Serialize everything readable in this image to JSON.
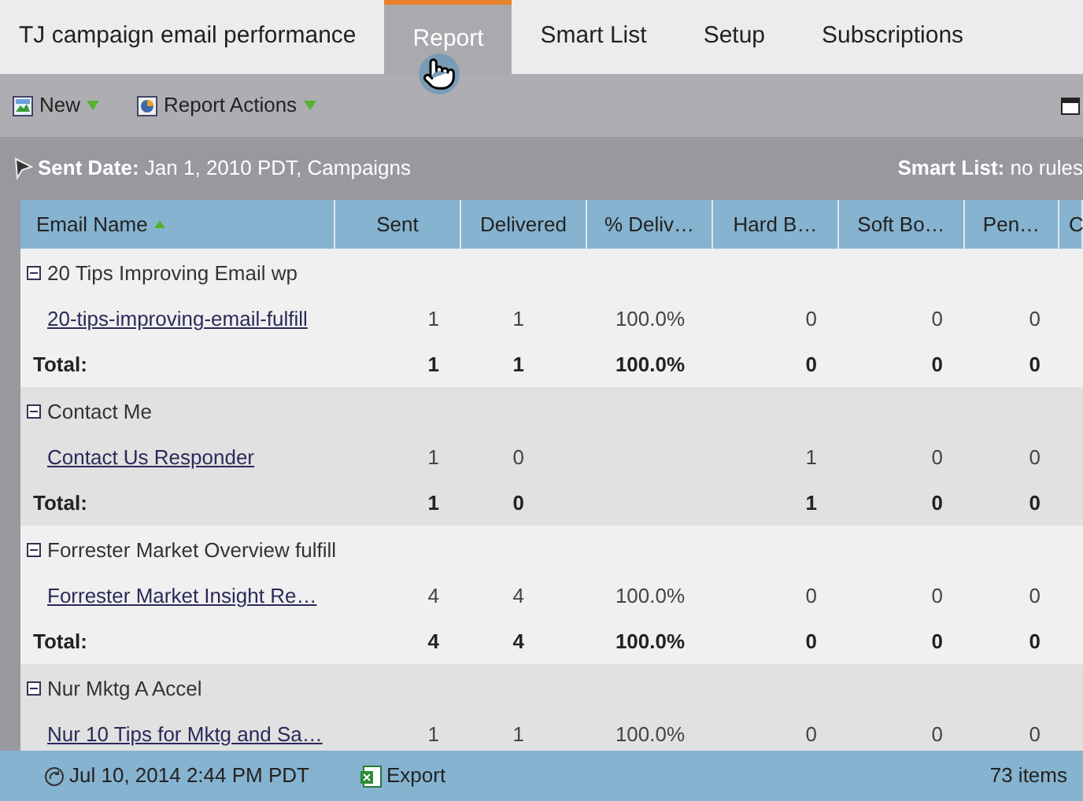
{
  "title": "TJ campaign email performance",
  "tabs": [
    {
      "label": "Report",
      "selected": true
    },
    {
      "label": "Smart List",
      "selected": false
    },
    {
      "label": "Setup",
      "selected": false
    },
    {
      "label": "Subscriptions",
      "selected": false
    }
  ],
  "toolbar": [
    {
      "label": "New",
      "kind": "new"
    },
    {
      "label": "Report Actions",
      "kind": "actions"
    }
  ],
  "filter": {
    "label": "Sent Date:",
    "value": "Jan 1, 2010 PDT, Campaigns",
    "smart_list_label": "Smart List:",
    "smart_list_value": "no rules"
  },
  "table": {
    "columns": [
      "Email Name",
      "Sent",
      "Delivered",
      "% Deliv…",
      "Hard B…",
      "Soft Bo…",
      "Pen…",
      "C"
    ],
    "groups": [
      {
        "name": "20 Tips Improving Email wp",
        "expanded": true,
        "rows": [
          {
            "name": "20-tips-improving-email-fulfill",
            "cells": [
              "1",
              "1",
              "100.0%",
              "0",
              "0",
              "0"
            ]
          }
        ],
        "total": {
          "label": "Total:",
          "cells": [
            "1",
            "1",
            "100.0%",
            "0",
            "0",
            "0"
          ]
        }
      },
      {
        "name": "Contact Me",
        "expanded": true,
        "rows": [
          {
            "name": "Contact Us Responder",
            "cells": [
              "1",
              "0",
              null,
              "1",
              "0",
              "0"
            ]
          }
        ],
        "total": {
          "label": "Total:",
          "cells": [
            "1",
            "0",
            null,
            "1",
            "0",
            "0"
          ]
        }
      },
      {
        "name": "Forrester Market Overview fulfill",
        "expanded": true,
        "rows": [
          {
            "name": "Forrester Market Insight Re…",
            "cells": [
              "4",
              "4",
              "100.0%",
              "0",
              "0",
              "0"
            ]
          }
        ],
        "total": {
          "label": "Total:",
          "cells": [
            "4",
            "4",
            "100.0%",
            "0",
            "0",
            "0"
          ]
        }
      },
      {
        "name": "Nur Mktg A Accel",
        "expanded": true,
        "rows": [
          {
            "name": "Nur 10 Tips for Mktg and Sa…",
            "cells": [
              "1",
              "1",
              "100.0%",
              "0",
              "0",
              "0"
            ]
          }
        ]
      }
    ]
  },
  "status_bar": {
    "date": "Jul 10, 2014 2:44 PM PDT",
    "export": "Export",
    "count": "73 items"
  }
}
